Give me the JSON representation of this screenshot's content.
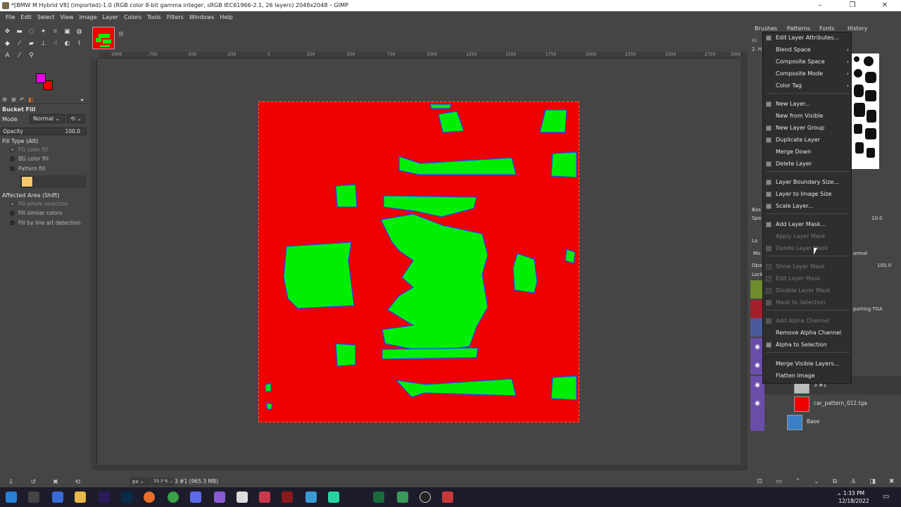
{
  "window": {
    "title": "*[BMW M Hybrid V8] (imported)-1.0 (RGB color 8-bit gamma integer, sRGB IEC61966-2.1, 26 layers) 2048x2048 – GIMP",
    "minimize": "–",
    "maximize": "❐",
    "close": "✕"
  },
  "menubar": [
    "File",
    "Edit",
    "Select",
    "View",
    "Image",
    "Layer",
    "Colors",
    "Tools",
    "Filters",
    "Windows",
    "Help"
  ],
  "toolbox": {
    "tool_icons": [
      "move-icon",
      "align-icon",
      "lasso-icon",
      "fuzzy-select-icon",
      "crop-icon",
      "unified-transform-icon",
      "warp-icon",
      "bucket-fill-icon",
      "paintbrush-icon",
      "eraser-icon",
      "clone-icon",
      "smudge-icon",
      "dodge-icon",
      "path-icon",
      "text-icon",
      "color-picker-icon",
      "zoom-icon"
    ],
    "fg_color": "#e800e8",
    "bg_color": "#ee0000"
  },
  "tool_options": {
    "title": "Bucket Fill",
    "mode_label": "Mode",
    "mode_value": "Normal",
    "opacity_label": "Opacity",
    "opacity_value": "100.0",
    "fill_type_label": "Fill Type  (Alt)",
    "fill_fg": "FG color fill",
    "fill_bg": "BG color fill",
    "fill_pattern": "Pattern fill",
    "pattern_color": "#f8c66a",
    "affected_label": "Affected Area  (Shift)",
    "affected_whole": "Fill whole selection",
    "affected_similar": "Fill similar colors",
    "affected_lineart": "Fill by line art detection"
  },
  "ruler": {
    "ticks": [
      "-1000",
      "-750",
      "-500",
      "-250",
      "0",
      "250",
      "500",
      "750",
      "1000",
      "1250",
      "1500",
      "1750",
      "2000",
      "2250",
      "2500",
      "2750",
      "3000"
    ]
  },
  "statusbar": {
    "unit": "px",
    "zoom": "33.3 %",
    "text": "3 #1 (965.3 MB)"
  },
  "dock": {
    "tabs": [
      "Brushes",
      "Patterns",
      "Fonts",
      "History"
    ],
    "partial_labels": {
      "filter": "Fil",
      "brush_name": "2. H",
      "basic": "Bas",
      "spacing": "Spa",
      "spacing_value": "10.0",
      "layers_tab": "La",
      "mode": "Mo",
      "mode_value": "ormal",
      "opacity": "Opa",
      "opacity_value": "100.0",
      "lock": "Lock",
      "layer_partial": "porting TGA"
    },
    "layers": [
      {
        "name": "3 #1"
      },
      {
        "name": "car_pattern_012.tga"
      },
      {
        "name": "Base"
      }
    ]
  },
  "context_menu": {
    "items": [
      {
        "label": "Edit Layer Attributes...",
        "disabled": false,
        "submenu": false
      },
      {
        "label": "Blend Space",
        "disabled": false,
        "submenu": true
      },
      {
        "label": "Composite Space",
        "disabled": false,
        "submenu": true
      },
      {
        "label": "Composite Mode",
        "disabled": false,
        "submenu": true
      },
      {
        "label": "Color Tag",
        "disabled": false,
        "submenu": true
      },
      {
        "label": "New Layer...",
        "disabled": false,
        "submenu": false
      },
      {
        "label": "New from Visible",
        "disabled": false,
        "submenu": false
      },
      {
        "label": "New Layer Group",
        "disabled": false,
        "submenu": false
      },
      {
        "label": "Duplicate Layer",
        "disabled": false,
        "submenu": false
      },
      {
        "label": "Merge Down",
        "disabled": false,
        "submenu": false
      },
      {
        "label": "Delete Layer",
        "disabled": false,
        "submenu": false
      },
      {
        "label": "Layer Boundary Size...",
        "disabled": false,
        "submenu": false
      },
      {
        "label": "Layer to Image Size",
        "disabled": false,
        "submenu": false
      },
      {
        "label": "Scale Layer...",
        "disabled": false,
        "submenu": false
      },
      {
        "label": "Add Layer Mask...",
        "disabled": false,
        "submenu": false
      },
      {
        "label": "Apply Layer Mask",
        "disabled": true,
        "submenu": false
      },
      {
        "label": "Delete Layer Mask",
        "disabled": true,
        "submenu": false
      },
      {
        "label": "Show Layer Mask",
        "disabled": true,
        "submenu": false
      },
      {
        "label": "Edit Layer Mask",
        "disabled": true,
        "submenu": false
      },
      {
        "label": "Disable Layer Mask",
        "disabled": true,
        "submenu": false
      },
      {
        "label": "Mask to Selection",
        "disabled": true,
        "submenu": false
      },
      {
        "label": "Add Alpha Channel",
        "disabled": true,
        "submenu": false
      },
      {
        "label": "Remove Alpha Channel",
        "disabled": false,
        "submenu": false
      },
      {
        "label": "Alpha to Selection",
        "disabled": false,
        "submenu": false
      },
      {
        "label": "Merge Visible Layers...",
        "disabled": false,
        "submenu": false
      },
      {
        "label": "Flatten Image",
        "disabled": false,
        "submenu": false
      }
    ]
  },
  "taskbar": {
    "time": "1:33 PM",
    "date": "12/18/2022",
    "apps": [
      "windows-start-icon",
      "task-view-icon",
      "store-icon",
      "file-explorer-icon",
      "premiere-icon",
      "photoshop-icon",
      "firefox-icon",
      "chrome-icon",
      "discord-icon",
      "app-icon",
      "inkscape-icon",
      "app-icon",
      "app-icon",
      "app-icon",
      "app-icon",
      "app-icon",
      "app-icon",
      "gimp-icon"
    ]
  },
  "colors": {
    "canvas_red": "#ee0000",
    "canvas_green": "#00ee00",
    "context_bg": "#2e2e2e",
    "layers_accent": "#6a4da8"
  }
}
